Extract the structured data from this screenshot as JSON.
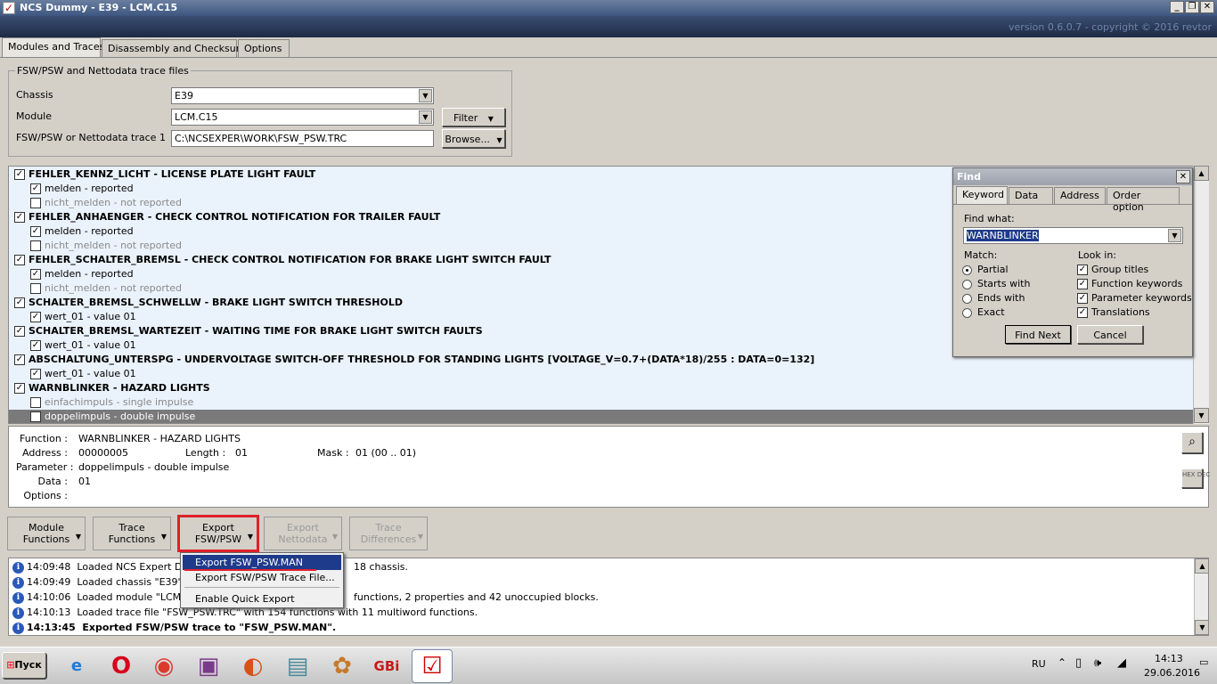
{
  "window": {
    "title": "NCS Dummy - E39 - LCM.C15",
    "version": "version 0.6.0.7 - copyright © 2016 revtor"
  },
  "tabs": [
    "Modules and Traces",
    "Disassembly and Checksums",
    "Options"
  ],
  "trace_group": {
    "legend": "FSW/PSW and Nettodata trace files",
    "chassis_label": "Chassis",
    "chassis_value": "E39",
    "module_label": "Module",
    "module_value": "LCM.C15",
    "trace_label": "FSW/PSW or Nettodata trace 1",
    "trace_value": "C:\\NCSEXPER\\WORK\\FSW_PSW.TRC",
    "filter_label": "Filter",
    "browse_label": "Browse..."
  },
  "functions": [
    {
      "text": "FEHLER_KENNZ_LICHT  -  LICENSE PLATE LIGHT FAULT",
      "checked": true
    },
    {
      "text": "melden  -  reported",
      "checked": true,
      "opt": true
    },
    {
      "text": "nicht_melden  -  not reported",
      "checked": false,
      "opt": true
    },
    {
      "text": "FEHLER_ANHAENGER  -  CHECK CONTROL NOTIFICATION FOR TRAILER FAULT",
      "checked": true
    },
    {
      "text": "melden  -  reported",
      "checked": true,
      "opt": true
    },
    {
      "text": "nicht_melden  -  not reported",
      "checked": false,
      "opt": true
    },
    {
      "text": "FEHLER_SCHALTER_BREMSL  -  CHECK CONTROL NOTIFICATION FOR BRAKE LIGHT SWITCH FAULT",
      "checked": true
    },
    {
      "text": "melden  -  reported",
      "checked": true,
      "opt": true
    },
    {
      "text": "nicht_melden  -  not reported",
      "checked": false,
      "opt": true
    },
    {
      "text": "SCHALTER_BREMSL_SCHWELLW  -  BRAKE LIGHT SWITCH THRESHOLD",
      "checked": true
    },
    {
      "text": "wert_01  -  value 01",
      "checked": true,
      "opt": true
    },
    {
      "text": "SCHALTER_BREMSL_WARTEZEIT  -  WAITING TIME FOR BRAKE LIGHT SWITCH FAULTS",
      "checked": true
    },
    {
      "text": "wert_01  -  value 01",
      "checked": true,
      "opt": true
    },
    {
      "text": "ABSCHALTUNG_UNTERSPG  -  UNDERVOLTAGE SWITCH-OFF THRESHOLD FOR STANDING LIGHTS [VOLTAGE_V=0.7+(DATA*18)/255 : DATA=0=132]",
      "checked": true
    },
    {
      "text": "wert_01  -  value 01",
      "checked": true,
      "opt": true
    },
    {
      "text": "WARNBLINKER  -  HAZARD LIGHTS",
      "checked": true
    },
    {
      "text": "einfachimpuls  -  single impulse",
      "checked": false,
      "opt": true
    },
    {
      "text": "doppelimpuls  -  double impulse",
      "checked": true,
      "opt": true,
      "selected": true
    }
  ],
  "find": {
    "title": "Find",
    "tabs": [
      "Keyword",
      "Data",
      "Address",
      "Order option"
    ],
    "find_what_label": "Find what:",
    "find_what_value": "WARNBLINKER",
    "match_label": "Match:",
    "match_options": [
      "Partial",
      "Starts with",
      "Ends with",
      "Exact"
    ],
    "look_in_label": "Look in:",
    "look_in_options": [
      "Group titles",
      "Function keywords",
      "Parameter keywords",
      "Translations"
    ],
    "find_next": "Find Next",
    "cancel": "Cancel"
  },
  "details": {
    "function_label": "Function :",
    "function_value": "WARNBLINKER  -  HAZARD LIGHTS",
    "address_label": "Address :",
    "address_value": "00000005",
    "length_label": "Length :",
    "length_value": "01",
    "mask_label": "Mask :",
    "mask_value": "01  (00 .. 01)",
    "parameter_label": "Parameter :",
    "parameter_value": "doppelimpuls  -  double impulse",
    "data_label": "Data :",
    "data_value": "01",
    "options_label": "Options :",
    "hex_label": "HEX DEC"
  },
  "toolbar": [
    {
      "l1": "Module",
      "l2": "Functions",
      "enabled": true
    },
    {
      "l1": "Trace",
      "l2": "Functions",
      "enabled": true
    },
    {
      "l1": "Export",
      "l2": "FSW/PSW",
      "enabled": true
    },
    {
      "l1": "Export",
      "l2": "Nettodata",
      "enabled": false
    },
    {
      "l1": "Trace",
      "l2": "Differences",
      "enabled": false
    }
  ],
  "export_menu": [
    "Export FSW_PSW.MAN",
    "Export FSW/PSW Trace File...",
    "Enable Quick Export"
  ],
  "log": [
    {
      "time": "14:09:48",
      "text": "Loaded NCS Expert DATE",
      "tail": "18 chassis."
    },
    {
      "time": "14:09:49",
      "text": "Loaded chassis \"E39\" wit",
      "tail": ""
    },
    {
      "time": "14:10:06",
      "text": "Loaded module \"LCM.C15",
      "tail": "functions, 2 properties and 42 unoccupied blocks."
    },
    {
      "time": "14:10:13",
      "text": "Loaded trace file \"FSW_PSW.TRC\" with 154 functions with 11 multiword functions.",
      "tail": ""
    },
    {
      "time": "14:13:45",
      "text": "Exported FSW/PSW trace to \"FSW_PSW.MAN\".",
      "tail": "",
      "bold": true
    }
  ],
  "taskbar": {
    "start": "Пуск",
    "lang": "RU",
    "time": "14:13",
    "date": "29.06.2016"
  }
}
